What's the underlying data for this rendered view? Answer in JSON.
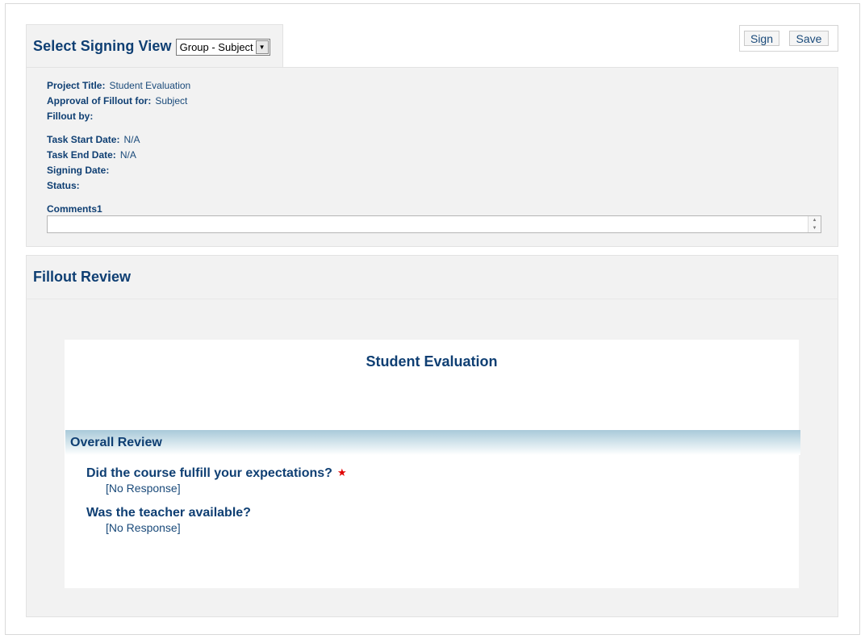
{
  "header": {
    "title": "Select Signing View",
    "view_selected": "Group - Subject"
  },
  "actions": {
    "sign_label": "Sign",
    "save_label": "Save"
  },
  "info": {
    "project_title_label": "Project Title:",
    "project_title_value": "Student Evaluation",
    "approval_label": "Approval of Fillout for:",
    "approval_value": "Subject",
    "fillout_by_label": "Fillout by:",
    "task_start_label": "Task Start Date:",
    "task_start_value": "N/A",
    "task_end_label": "Task End Date:",
    "task_end_value": "N/A",
    "signing_date_label": "Signing Date:",
    "status_label": "Status:",
    "comments_label": "Comments1",
    "comments_value": ""
  },
  "review": {
    "title": "Fillout Review",
    "form_title": "Student Evaluation",
    "section_title": "Overall Review",
    "questions": [
      {
        "text": "Did the course fulfill your expectations?",
        "required": true,
        "answer": "[No Response]"
      },
      {
        "text": "Was the teacher available?",
        "required": false,
        "answer": "[No Response]"
      }
    ],
    "required_marker": "★"
  },
  "colors": {
    "heading": "#0f3f73",
    "text": "#1a4a7a",
    "panel_bg": "#f2f2f2",
    "required": "#e00000"
  }
}
